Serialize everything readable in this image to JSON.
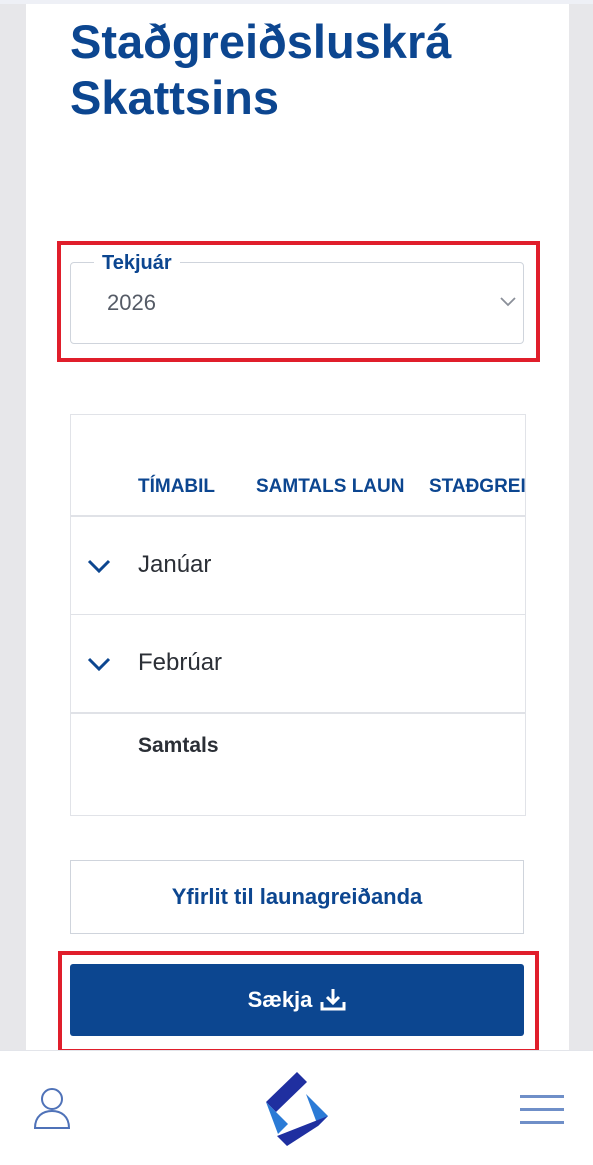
{
  "page": {
    "title_line1": "Staðgreiðsluskrá",
    "title_line2": "Skattsins"
  },
  "year_select": {
    "label": "Tekjuár",
    "value": "2026",
    "icon": "chevron-down-icon"
  },
  "table": {
    "headers": [
      "TÍMABIL",
      "SAMTALS LAUN",
      "STAÐGREI"
    ],
    "rows": [
      {
        "label": "Janúar",
        "icon": "chevron-down-icon"
      },
      {
        "label": "Febrúar",
        "icon": "chevron-down-icon"
      }
    ],
    "total_label": "Samtals"
  },
  "buttons": {
    "overview_label": "Yfirlit til launagreiðanda",
    "download_label": "Sækja",
    "download_icon": "download-icon"
  },
  "bottom_nav": {
    "profile_icon": "user-icon",
    "logo_icon": "skatturinn-logo-icon",
    "menu_icon": "hamburger-menu-icon"
  },
  "colors": {
    "primary": "#0c4690",
    "highlight": "#e01e2b",
    "background": "#e7e7ea"
  }
}
